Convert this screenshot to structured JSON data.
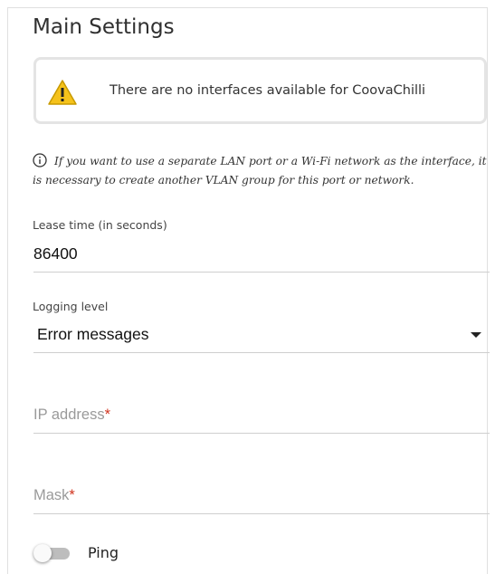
{
  "section": {
    "title": "Main Settings"
  },
  "warning": {
    "icon": "warning-triangle-icon",
    "text": "There are no interfaces available for CoovaChilli"
  },
  "hint": {
    "icon": "info-icon",
    "text": "If you want to use a separate LAN port or a Wi-Fi network as the interface, it is necessary to create another VLAN group for this port or network."
  },
  "lease_time": {
    "label": "Lease time (in seconds)",
    "value": "86400"
  },
  "logging_level": {
    "label": "Logging level",
    "value": "Error messages",
    "icon": "dropdown-caret-icon"
  },
  "ip_address": {
    "placeholder": "IP address",
    "required_mark": "*"
  },
  "mask": {
    "placeholder": "Mask",
    "required_mark": "*"
  },
  "ping": {
    "label": "Ping",
    "enabled": false
  },
  "colors": {
    "required": "#d0341f",
    "warning_fill": "#f5c21b",
    "toggle_off": "#bdbdbd"
  }
}
